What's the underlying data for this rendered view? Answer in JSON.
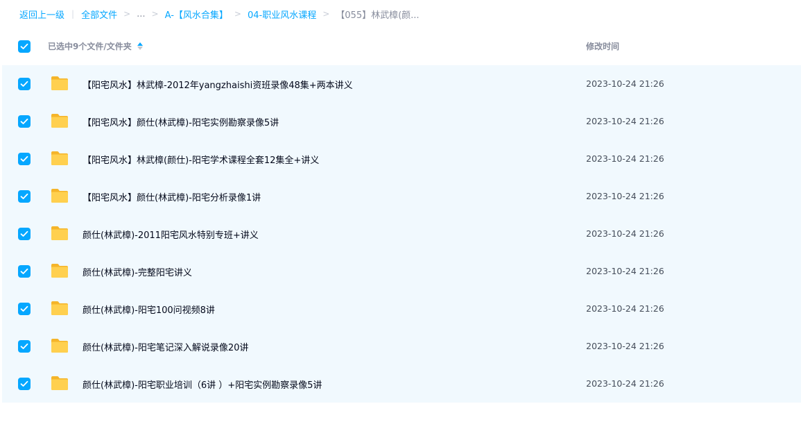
{
  "breadcrumb": {
    "back": "返回上一级",
    "divider": "|",
    "all_files": "全部文件",
    "ellipsis": "...",
    "level1": "A-【风水合集】",
    "level2": "04-职业风水课程",
    "current": "【055】林武樟(颜...",
    "separator": ">"
  },
  "header": {
    "selection_label": "已选中9个文件/文件夹",
    "time_label": "修改时间"
  },
  "files": [
    {
      "name": "【阳宅风水】林武樟-2012年yangzhaishi资班录像48集+两本讲义",
      "modified": "2023-10-24 21:26",
      "checked": true,
      "icon": "folder-icon"
    },
    {
      "name": "【阳宅风水】颜仕(林武樟)-阳宅实例勘察录像5讲",
      "modified": "2023-10-24 21:26",
      "checked": true,
      "icon": "folder-icon"
    },
    {
      "name": "【阳宅风水】林武樟(颜仕)-阳宅学术课程全套12集全+讲义",
      "modified": "2023-10-24 21:26",
      "checked": true,
      "icon": "folder-icon"
    },
    {
      "name": "【阳宅风水】颜仕(林武樟)-阳宅分析录像1讲",
      "modified": "2023-10-24 21:26",
      "checked": true,
      "icon": "folder-icon"
    },
    {
      "name": "颜仕(林武樟)-2011阳宅风水特别专班+讲义",
      "modified": "2023-10-24 21:26",
      "checked": true,
      "icon": "folder-icon"
    },
    {
      "name": "颜仕(林武樟)-完整阳宅讲义",
      "modified": "2023-10-24 21:26",
      "checked": true,
      "icon": "folder-icon"
    },
    {
      "name": "颜仕(林武樟)-阳宅100问视频8讲",
      "modified": "2023-10-24 21:26",
      "checked": true,
      "icon": "folder-icon"
    },
    {
      "name": "颜仕(林武樟)-阳宅笔记深入解说录像20讲",
      "modified": "2023-10-24 21:26",
      "checked": true,
      "icon": "folder-icon"
    },
    {
      "name": "颜仕(林武樟)-阳宅职业培训（6讲 ）+阳宅实例勘察录像5讲",
      "modified": "2023-10-24 21:26",
      "checked": true,
      "icon": "folder-icon"
    }
  ],
  "colors": {
    "accent": "#06a7ff",
    "row_bg": "#f1f9fe",
    "folder": "#ffc93e"
  }
}
